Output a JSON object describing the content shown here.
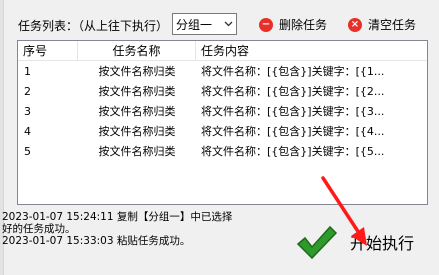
{
  "toolbar": {
    "task_list_label": "任务列表：（从上往下执行）",
    "group_select_value": "分组一",
    "delete_task_label": "删除任务",
    "clear_task_label": "清空任务"
  },
  "table": {
    "headers": [
      "序号",
      "任务名称",
      "任务内容"
    ],
    "rows": [
      {
        "index": "1",
        "name": "按文件名称归类",
        "content": "将文件名称：[{包含}]关键字：[{1..."
      },
      {
        "index": "2",
        "name": "按文件名称归类",
        "content": "将文件名称：[{包含}]关键字：[{2..."
      },
      {
        "index": "3",
        "name": "按文件名称归类",
        "content": "将文件名称：[{包含}]关键字：[{3..."
      },
      {
        "index": "4",
        "name": "按文件名称归类",
        "content": "将文件名称：[{包含}]关键字：[{4..."
      },
      {
        "index": "5",
        "name": "按文件名称归类",
        "content": "将文件名称：[{包含}]关键字：[{5..."
      }
    ]
  },
  "log": {
    "lines": [
      "2023-01-07 15:24:11 复制【分组一】中已选择",
      "好的任务成功。",
      "2023-01-07 15:33:03 粘贴任务成功。"
    ]
  },
  "start_button": {
    "label": "开始执行"
  },
  "colors": {
    "accent_red": "#e8302a",
    "check_green": "#2e9a2a"
  }
}
